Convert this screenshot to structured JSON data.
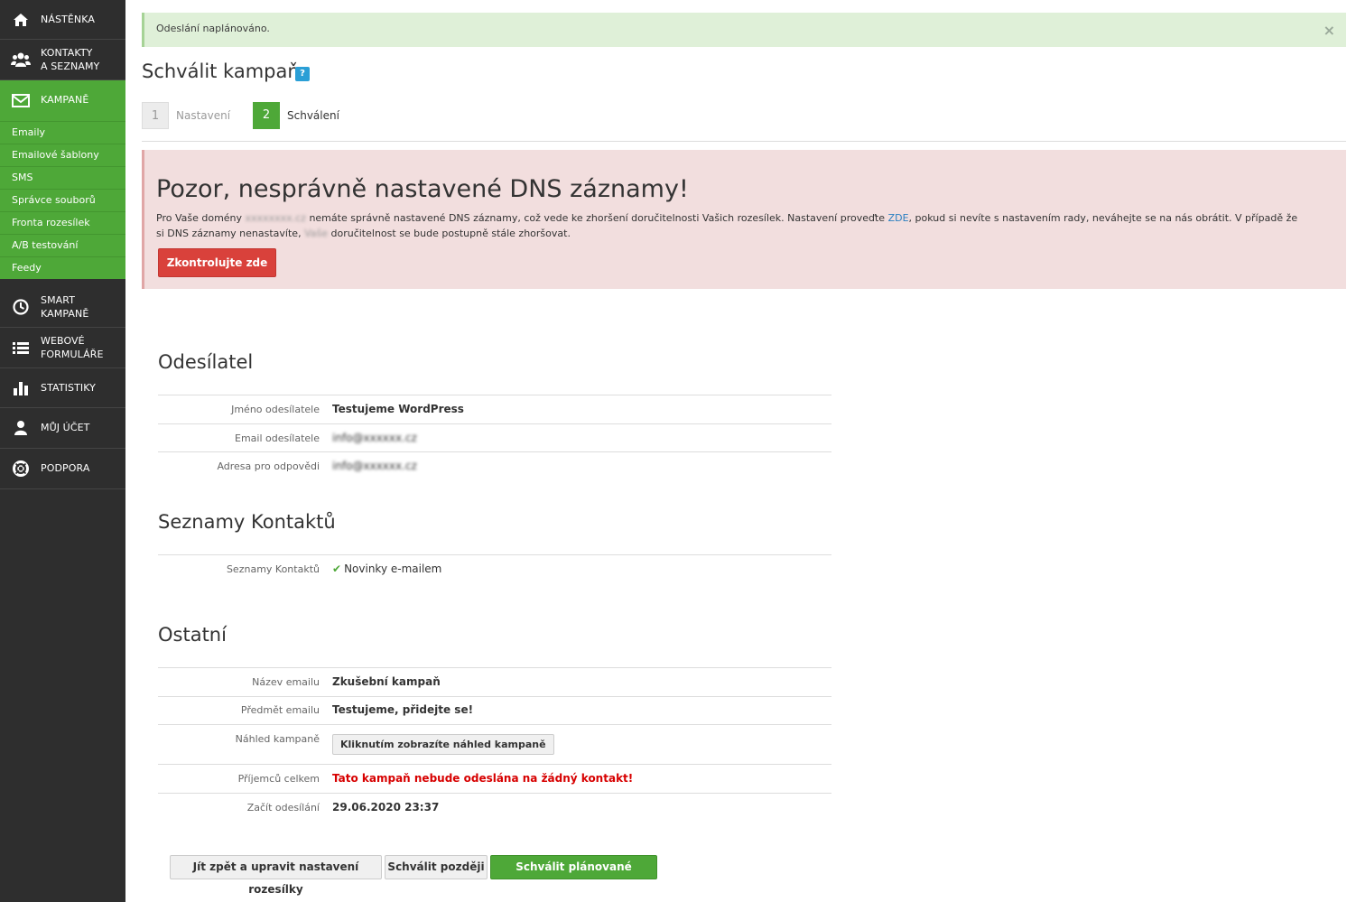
{
  "sidebar": {
    "items": [
      {
        "label_1": "NÁSTĚNKA",
        "label_2": "",
        "icon": "home-icon"
      },
      {
        "label_1": "KONTAKTY",
        "label_2": "A SEZNAMY",
        "icon": "users-icon"
      },
      {
        "label_1": "KAMPANĚ",
        "label_2": "",
        "icon": "envelope-icon"
      },
      {
        "label_1": "SMART",
        "label_2": "KAMPANĚ",
        "icon": "clock-icon"
      },
      {
        "label_1": "WEBOVÉ",
        "label_2": "FORMULÁŘE",
        "icon": "list-icon"
      },
      {
        "label_1": "STATISTIKY",
        "label_2": "",
        "icon": "bar-chart-icon"
      },
      {
        "label_1": "MŮJ ÚČET",
        "label_2": "",
        "icon": "user-icon"
      },
      {
        "label_1": "PODPORA",
        "label_2": "",
        "icon": "lifebuoy-icon"
      }
    ],
    "subitems": [
      "Emaily",
      "Emailové šablony",
      "SMS",
      "Správce souborů",
      "Fronta rozesílek",
      "A/B testování",
      "Feedy"
    ],
    "active_color": "#4ea838",
    "bg_color": "#2e2e2e"
  },
  "success_alert": {
    "message": "Odeslání naplánováno.",
    "close": "×"
  },
  "page": {
    "title": "Schválit kampaň",
    "help": "?"
  },
  "steps": [
    {
      "num": "1",
      "label": "Nastavení"
    },
    {
      "num": "2",
      "label": "Schválení"
    }
  ],
  "dns_alert": {
    "heading": "Pozor, nesprávně nastavené DNS záznamy!",
    "text_1": "Pro Vaše domény",
    "domain": "xxxxxxxx.cz",
    "text_2": "nemáte správně nastavené DNS záznamy, což vede ke zhoršení doručitelnosti Vašich rozesílek. Nastavení proveďte",
    "link": "ZDE",
    "text_3": ", pokud si nevíte s nastavením rady, neváhejte se na nás obrátit. V případě že si DNS záznamy nenastavíte,",
    "blur_2": "Vaše",
    "text_4": "doručitelnost se bude postupně stále zhoršovat.",
    "button": "Zkontrolujte zde"
  },
  "sender": {
    "title": "Odesílatel",
    "name_label": "Jméno odesílatele",
    "name_value": "Testujeme WordPress",
    "email_label": "Email odesílatele",
    "email_value": "info@xxxxxx.cz",
    "reply_label": "Adresa pro odpovědi",
    "reply_value": "info@xxxxxx.cz"
  },
  "contacts": {
    "title": "Seznamy Kontaktů",
    "label": "Seznamy Kontaktů",
    "value": "Novinky e-mailem"
  },
  "other": {
    "title": "Ostatní",
    "email_name_label": "Název emailu",
    "email_name_value": "Zkušební kampaň",
    "subject_label": "Předmět emailu",
    "subject_value": "Testujeme, přidejte se!",
    "preview_label": "Náhled kampaně",
    "preview_button": "Kliknutím zobrazíte náhled kampaně",
    "recipients_label": "Příjemců celkem",
    "recipients_value": "Tato kampaň nebude odeslána na žádný kontakt!",
    "start_label": "Začít odesílání",
    "start_value": "29.06.2020 23:37"
  },
  "actions": {
    "back": "Jít zpět a upravit nastavení rozesílky",
    "later": "Schválit později",
    "approve": "Schválit plánované odeslání"
  }
}
